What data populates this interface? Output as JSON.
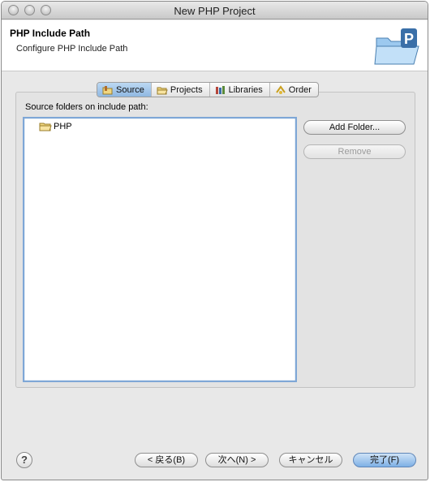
{
  "window": {
    "title": "New PHP Project"
  },
  "header": {
    "title": "PHP Include Path",
    "description": "Configure PHP Include Path",
    "icon": "php-folder-icon"
  },
  "tabs": [
    {
      "label": "Source",
      "icon": "source-icon",
      "selected": true
    },
    {
      "label": "Projects",
      "icon": "projects-icon",
      "selected": false
    },
    {
      "label": "Libraries",
      "icon": "libraries-icon",
      "selected": false
    },
    {
      "label": "Order",
      "icon": "order-icon",
      "selected": false
    }
  ],
  "source": {
    "list_label": "Source folders on include path:",
    "items": [
      {
        "label": "PHP",
        "icon": "folder-icon"
      }
    ],
    "add_folder_label": "Add Folder...",
    "remove_label": "Remove"
  },
  "footer": {
    "help_icon": "help-icon",
    "back_label": "< 戻る(B)",
    "next_label": "次へ(N) >",
    "cancel_label": "キャンセル",
    "finish_label": "完了(F)"
  },
  "colors": {
    "accent": "#7eb0e5",
    "selected_tab": "#9fc4ea"
  }
}
